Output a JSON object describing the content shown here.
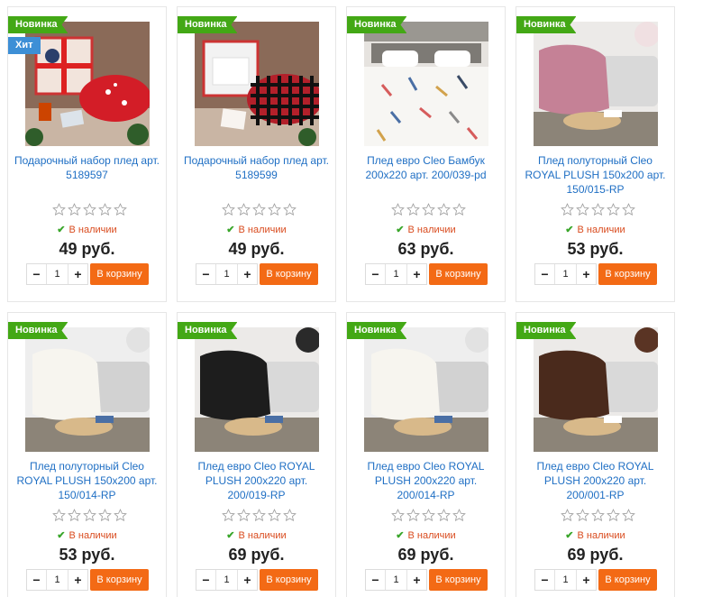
{
  "products": [
    {
      "badges": [
        "Новинка",
        "Хит"
      ],
      "title": "Подарочный набор плед арт. 5189597",
      "stock": "В наличии",
      "price": "49 руб.",
      "qty": "1",
      "cart": "В корзину",
      "scene": "gift-red"
    },
    {
      "badges": [
        "Новинка"
      ],
      "title": "Подарочный набор плед арт. 5189599",
      "stock": "В наличии",
      "price": "49 руб.",
      "qty": "1",
      "cart": "В корзину",
      "scene": "gift-check"
    },
    {
      "badges": [
        "Новинка"
      ],
      "title": "Плед евро Cleo Бамбук 200x220 арт. 200/039-pd",
      "stock": "В наличии",
      "price": "63 руб.",
      "qty": "1",
      "cart": "В корзину",
      "scene": "bed"
    },
    {
      "badges": [
        "Новинка"
      ],
      "title": "Плед полуторный Cleo ROYAL PLUSH 150x200 арт. 150/015-RP",
      "stock": "В наличии",
      "price": "53 руб.",
      "qty": "1",
      "cart": "В корзину",
      "scene": "pink"
    },
    {
      "badges": [
        "Новинка"
      ],
      "title": "Плед полуторный Cleo ROYAL PLUSH 150x200 арт. 150/014-RP",
      "stock": "В наличии",
      "price": "53 руб.",
      "qty": "1",
      "cart": "В корзину",
      "scene": "white"
    },
    {
      "badges": [
        "Новинка"
      ],
      "title": "Плед евро Cleo ROYAL PLUSH 200x220 арт. 200/019-RP",
      "stock": "В наличии",
      "price": "69 руб.",
      "qty": "1",
      "cart": "В корзину",
      "scene": "black"
    },
    {
      "badges": [
        "Новинка"
      ],
      "title": "Плед евро Cleo ROYAL PLUSH 200x220 арт. 200/014-RP",
      "stock": "В наличии",
      "price": "69 руб.",
      "qty": "1",
      "cart": "В корзину",
      "scene": "white"
    },
    {
      "badges": [
        "Новинка"
      ],
      "title": "Плед евро Cleo ROYAL PLUSH 200x220 арт. 200/001-RP",
      "stock": "В наличии",
      "price": "69 руб.",
      "qty": "1",
      "cart": "В корзину",
      "scene": "brown"
    }
  ],
  "colors": {
    "accent": "#f36a15",
    "link": "#1f6fc4",
    "new_badge": "#43a815",
    "hit_badge": "#3d8fd6",
    "stock": "#d94b1e"
  },
  "icons": {
    "minus": "minus-icon",
    "plus": "plus-icon",
    "check": "check-icon",
    "star": "star-outline-icon"
  }
}
